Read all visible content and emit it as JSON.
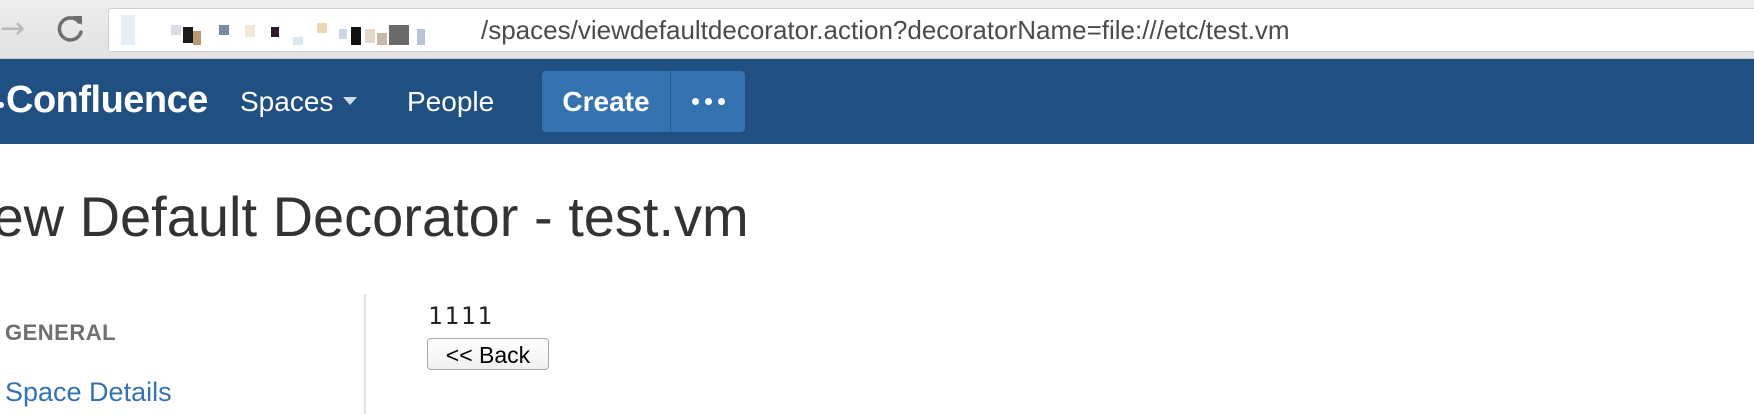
{
  "browser": {
    "url": "/spaces/viewdefaultdecorator.action?decoratorName=file:///etc/test.vm"
  },
  "header": {
    "logo": "Confluence",
    "nav": {
      "spaces": "Spaces",
      "people": "People"
    },
    "create_label": "Create"
  },
  "page": {
    "title": "iew Default Decorator - test.vm"
  },
  "sidebar": {
    "heading": "GENERAL",
    "items": [
      {
        "label": "Space Details"
      }
    ]
  },
  "content": {
    "file_text": "1111",
    "back_label": "<< Back"
  },
  "colors": {
    "header_bg": "#205081",
    "button_bg": "#3572b0",
    "link": "#3572b0"
  }
}
